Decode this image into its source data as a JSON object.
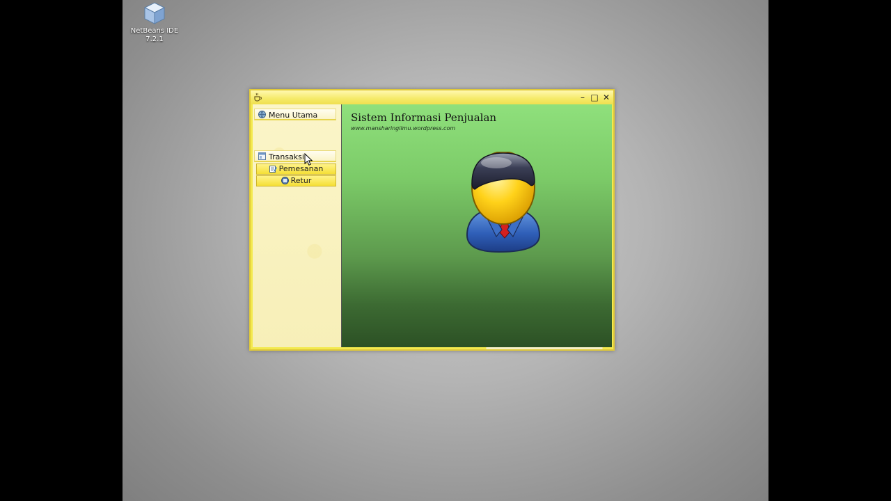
{
  "desktop": {
    "icon_label_line1": "NetBeans IDE",
    "icon_label_line2": "7.2.1"
  },
  "window": {
    "controls": {
      "minimize": "–",
      "maximize": "□",
      "close": "✕"
    }
  },
  "sidebar": {
    "menu_utama": "Menu Utama",
    "transaksi": "Transaksi",
    "items": [
      {
        "label": "Pemesanan",
        "icon": "form-edit-icon"
      },
      {
        "label": "Retur",
        "icon": "return-icon"
      }
    ]
  },
  "main": {
    "title": "Sistem Informasi Penjualan",
    "url": "www.mansharingilmu.wordpress.com",
    "avatar": "user-avatar-icon"
  },
  "colors": {
    "window_frame": "#f3e94e",
    "content_top": "#8fe07c",
    "content_bottom": "#2b4f24"
  }
}
